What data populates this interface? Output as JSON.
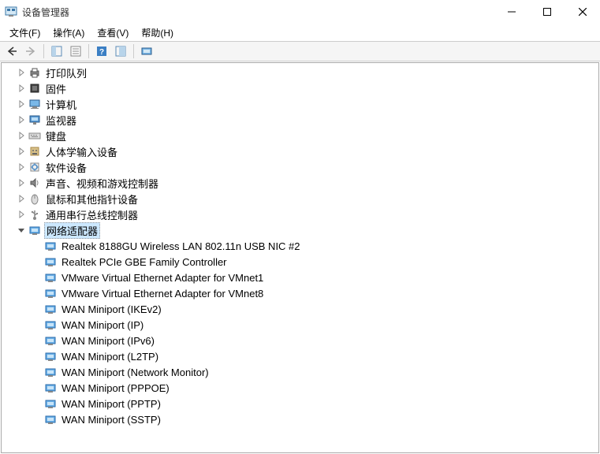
{
  "window": {
    "title": "设备管理器"
  },
  "menus": {
    "file": "文件(F)",
    "action": "操作(A)",
    "view": "查看(V)",
    "help": "帮助(H)"
  },
  "tree": {
    "categories": [
      {
        "label": "打印队列",
        "icon": "printer",
        "expanded": false
      },
      {
        "label": "固件",
        "icon": "firmware",
        "expanded": false
      },
      {
        "label": "计算机",
        "icon": "computer",
        "expanded": false
      },
      {
        "label": "监视器",
        "icon": "monitor",
        "expanded": false
      },
      {
        "label": "键盘",
        "icon": "keyboard",
        "expanded": false
      },
      {
        "label": "人体学输入设备",
        "icon": "hid",
        "expanded": false
      },
      {
        "label": "软件设备",
        "icon": "software",
        "expanded": false
      },
      {
        "label": "声音、视频和游戏控制器",
        "icon": "sound",
        "expanded": false
      },
      {
        "label": "鼠标和其他指针设备",
        "icon": "mouse",
        "expanded": false
      },
      {
        "label": "通用串行总线控制器",
        "icon": "usb",
        "expanded": false
      },
      {
        "label": "网络适配器",
        "icon": "network",
        "expanded": true,
        "selected": true,
        "children": [
          {
            "label": "Realtek 8188GU Wireless LAN 802.11n USB NIC #2",
            "icon": "network"
          },
          {
            "label": "Realtek PCIe GBE Family Controller",
            "icon": "network"
          },
          {
            "label": "VMware Virtual Ethernet Adapter for VMnet1",
            "icon": "network"
          },
          {
            "label": "VMware Virtual Ethernet Adapter for VMnet8",
            "icon": "network"
          },
          {
            "label": "WAN Miniport (IKEv2)",
            "icon": "network"
          },
          {
            "label": "WAN Miniport (IP)",
            "icon": "network"
          },
          {
            "label": "WAN Miniport (IPv6)",
            "icon": "network"
          },
          {
            "label": "WAN Miniport (L2TP)",
            "icon": "network"
          },
          {
            "label": "WAN Miniport (Network Monitor)",
            "icon": "network"
          },
          {
            "label": "WAN Miniport (PPPOE)",
            "icon": "network"
          },
          {
            "label": "WAN Miniport (PPTP)",
            "icon": "network"
          },
          {
            "label": "WAN Miniport (SSTP)",
            "icon": "network"
          }
        ]
      }
    ]
  }
}
